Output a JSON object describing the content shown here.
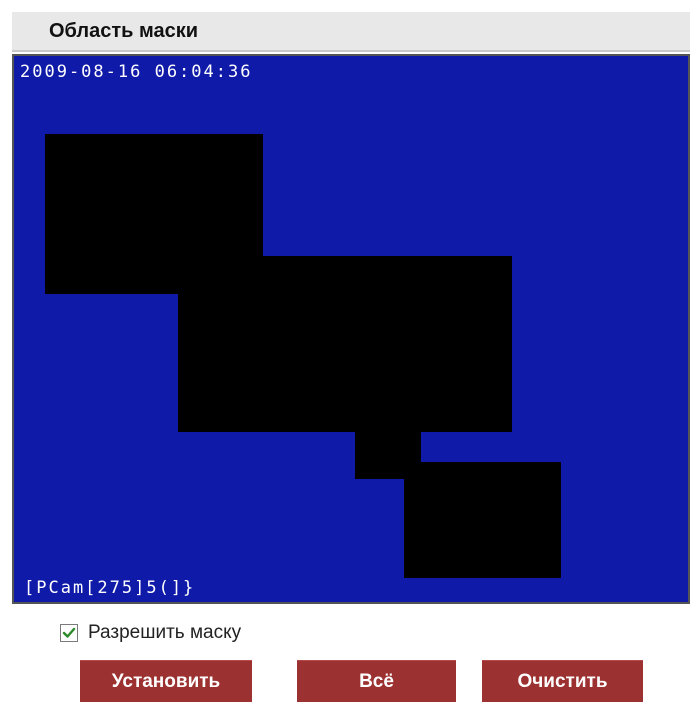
{
  "header": {
    "title": "Область маски"
  },
  "video": {
    "timestamp": "2009-08-16 06:04:36",
    "camera_name": "[PCam[275]5(]}",
    "background_color": "#0f1aa8",
    "mask_color": "#000000",
    "mask_region_count": 4
  },
  "enable_mask": {
    "checked": true,
    "label": "Разрешить маску"
  },
  "buttons": {
    "set_label": "Установить",
    "all_label": "Всё",
    "clear_label": "Очистить",
    "color": "#9c3131"
  }
}
